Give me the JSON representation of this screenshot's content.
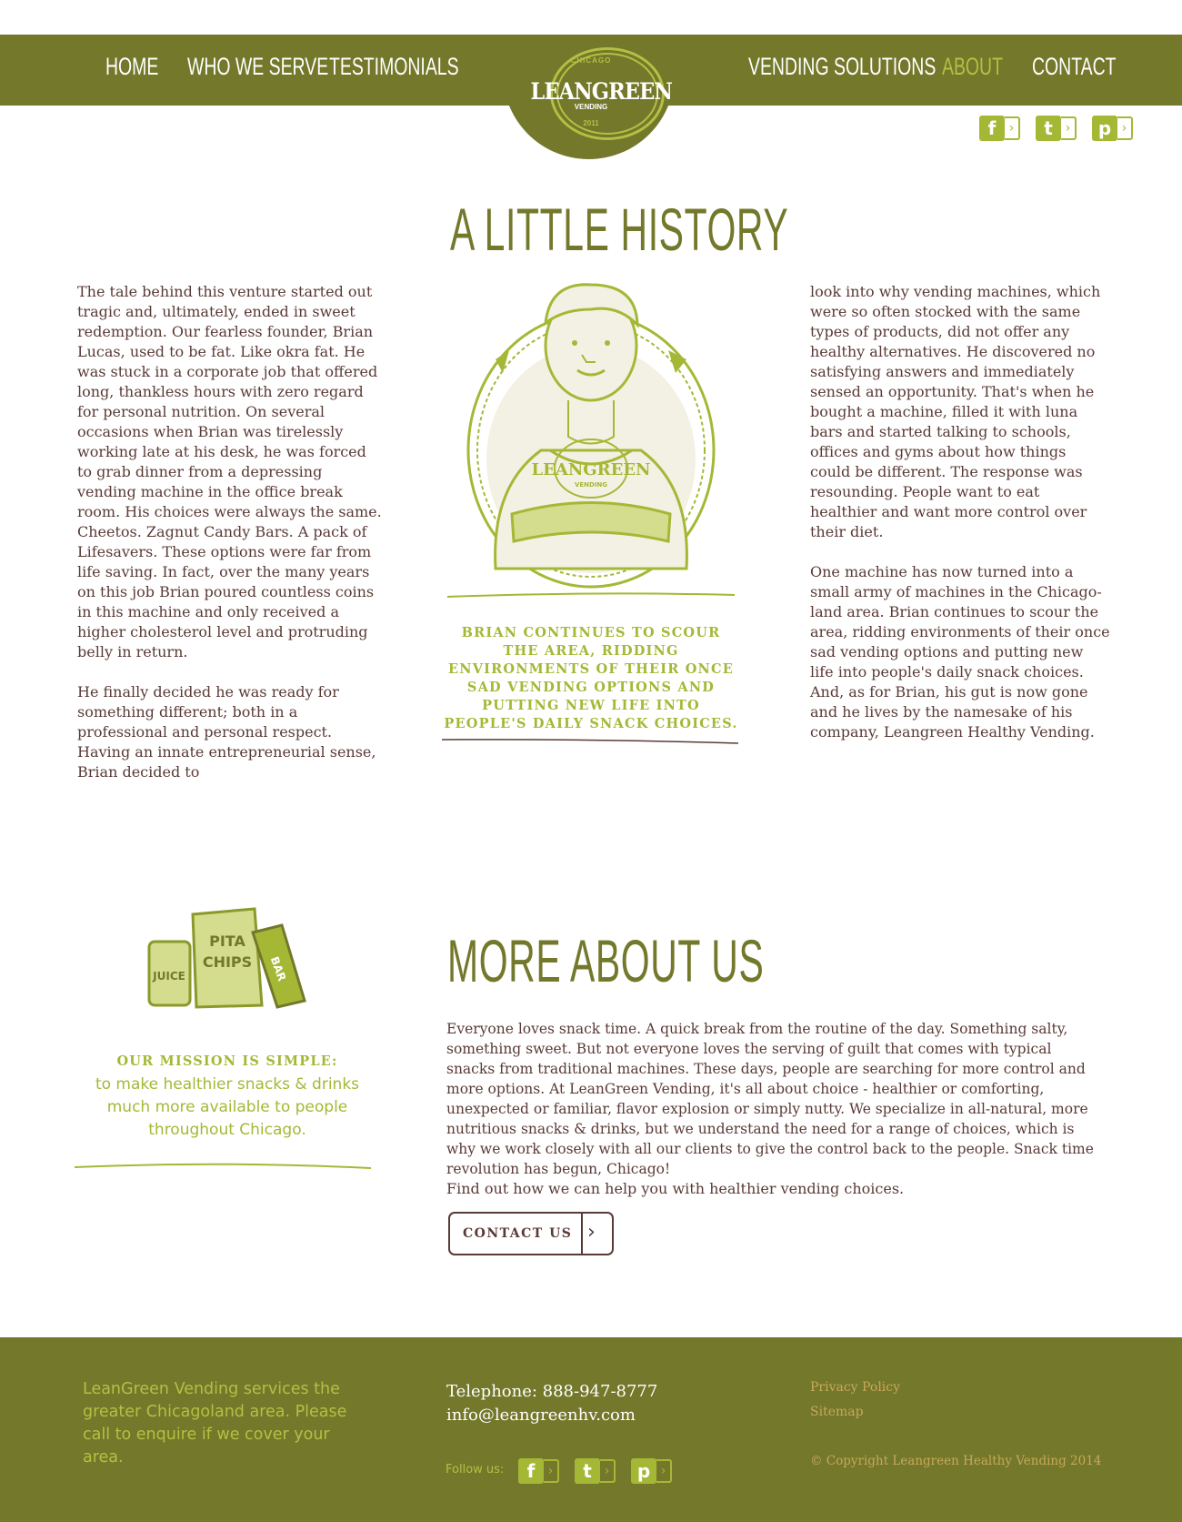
{
  "colors": {
    "olive": "#73782b",
    "lime": "#a5b836",
    "light_lime": "#b3c043",
    "brown": "#5a3a36",
    "gold": "#c8a85a"
  },
  "nav": {
    "home": "HOME",
    "who_we_serve": "WHO WE SERVE",
    "testimonials": "TESTIMONIALS",
    "vending_solutions": "VENDING SOLUTIONS",
    "about": "ABOUT",
    "contact": "CONTACT"
  },
  "logo": {
    "top": "CHICAGO",
    "name": "LEANGREEN",
    "sub": "VENDING",
    "year": "2011"
  },
  "social": {
    "facebook": {
      "glyph": "f",
      "icon": "facebook-icon"
    },
    "twitter": {
      "glyph": "t",
      "icon": "twitter-icon"
    },
    "pinterest": {
      "glyph": "p",
      "icon": "pinterest-icon"
    },
    "arrow": "›"
  },
  "history": {
    "title": "A LITTLE HISTORY",
    "left_text": "The tale behind this venture started out tragic and, ultimately, ended in sweet redemption.  Our fearless founder, Brian Lucas, used to be fat. Like okra fat. He was stuck in a corporate job that offered long, thankless hours with zero regard for personal nutrition. On several occasions when Brian was tirelessly working late at his desk, he was forced to grab dinner from a depressing vending machine in the office break room. His choices were always the same. Cheetos. Zagnut Candy Bars. A pack of Lifesavers. These options were far from life saving.  In fact, over the many years on this job Brian poured countless coins in this machine and only received a higher cholesterol level and protruding belly in return.\n\nHe finally decided he was ready for something different; both in a professional and personal respect. Having an innate entrepreneurial sense, Brian decided to",
    "right_text": "look into why vending machines, which were so often stocked with the same types of products, did not offer any healthy alternatives. He discovered no satisfying answers and immediately sensed an opportunity. That's when he bought a machine, filled it with luna bars and started talking to schools, offices and gyms about how things could be different. The response was resounding. People want to eat healthier and want more control over their diet.\n\nOne machine has now turned into a small army of machines in the Chicago-land area. Brian continues to scour the area, ridding environments of their once sad vending options and putting new life into people's daily snack choices. And, as for Brian, his gut is now gone and he lives by the namesake of his company, Leangreen Healthy Vending.",
    "caption": "BRIAN CONTINUES TO SCOUR THE AREA, RIDDING ENVIRONMENTS OF THEIR ONCE SAD VENDING OPTIONS AND PUTTING NEW LIFE INTO PEOPLE'S DAILY SNACK CHOICES.",
    "illustration": {
      "shirt_logo": "LEANGREEN",
      "shirt_sub": "VENDING"
    }
  },
  "mission": {
    "illustration": {
      "can": "JUICE",
      "bag_top": "PITA",
      "bag_bottom": "CHIPS",
      "bar": "BAR"
    },
    "heading": "OUR MISSION IS SIMPLE:",
    "body": "to make healthier snacks & drinks much more available to people throughout Chicago."
  },
  "about": {
    "title": "MORE ABOUT US",
    "body": "Everyone loves snack time. A quick break from the routine of the day. Something salty, something sweet. But not everyone loves the serving of guilt that comes with typical snacks from traditional machines. These days, people are searching for more control and more options. At LeanGreen Vending, it's all about choice - healthier or comforting, unexpected or familiar, flavor explosion or simply nutty. We specialize in all-natural, more nutritious snacks & drinks, but we understand the need for a range of choices, which is why we work closely with all our clients to give the control back to the people. Snack time revolution has begun, Chicago!",
    "find_out": "Find out how we can help you with healthier vending choices.",
    "button": "CONTACT US",
    "button_arrow": "›"
  },
  "footer": {
    "service_text": "LeanGreen Vending services the greater Chicagoland area. Please call to enquire if we cover your area.",
    "telephone": "Telephone: 888-947-8777",
    "email": "info@leangreenhv.com",
    "follow": "Follow us:",
    "privacy": "Privacy Policy",
    "sitemap": "Sitemap",
    "copyright": "© Copyright Leangreen Healthy Vending 2014"
  }
}
